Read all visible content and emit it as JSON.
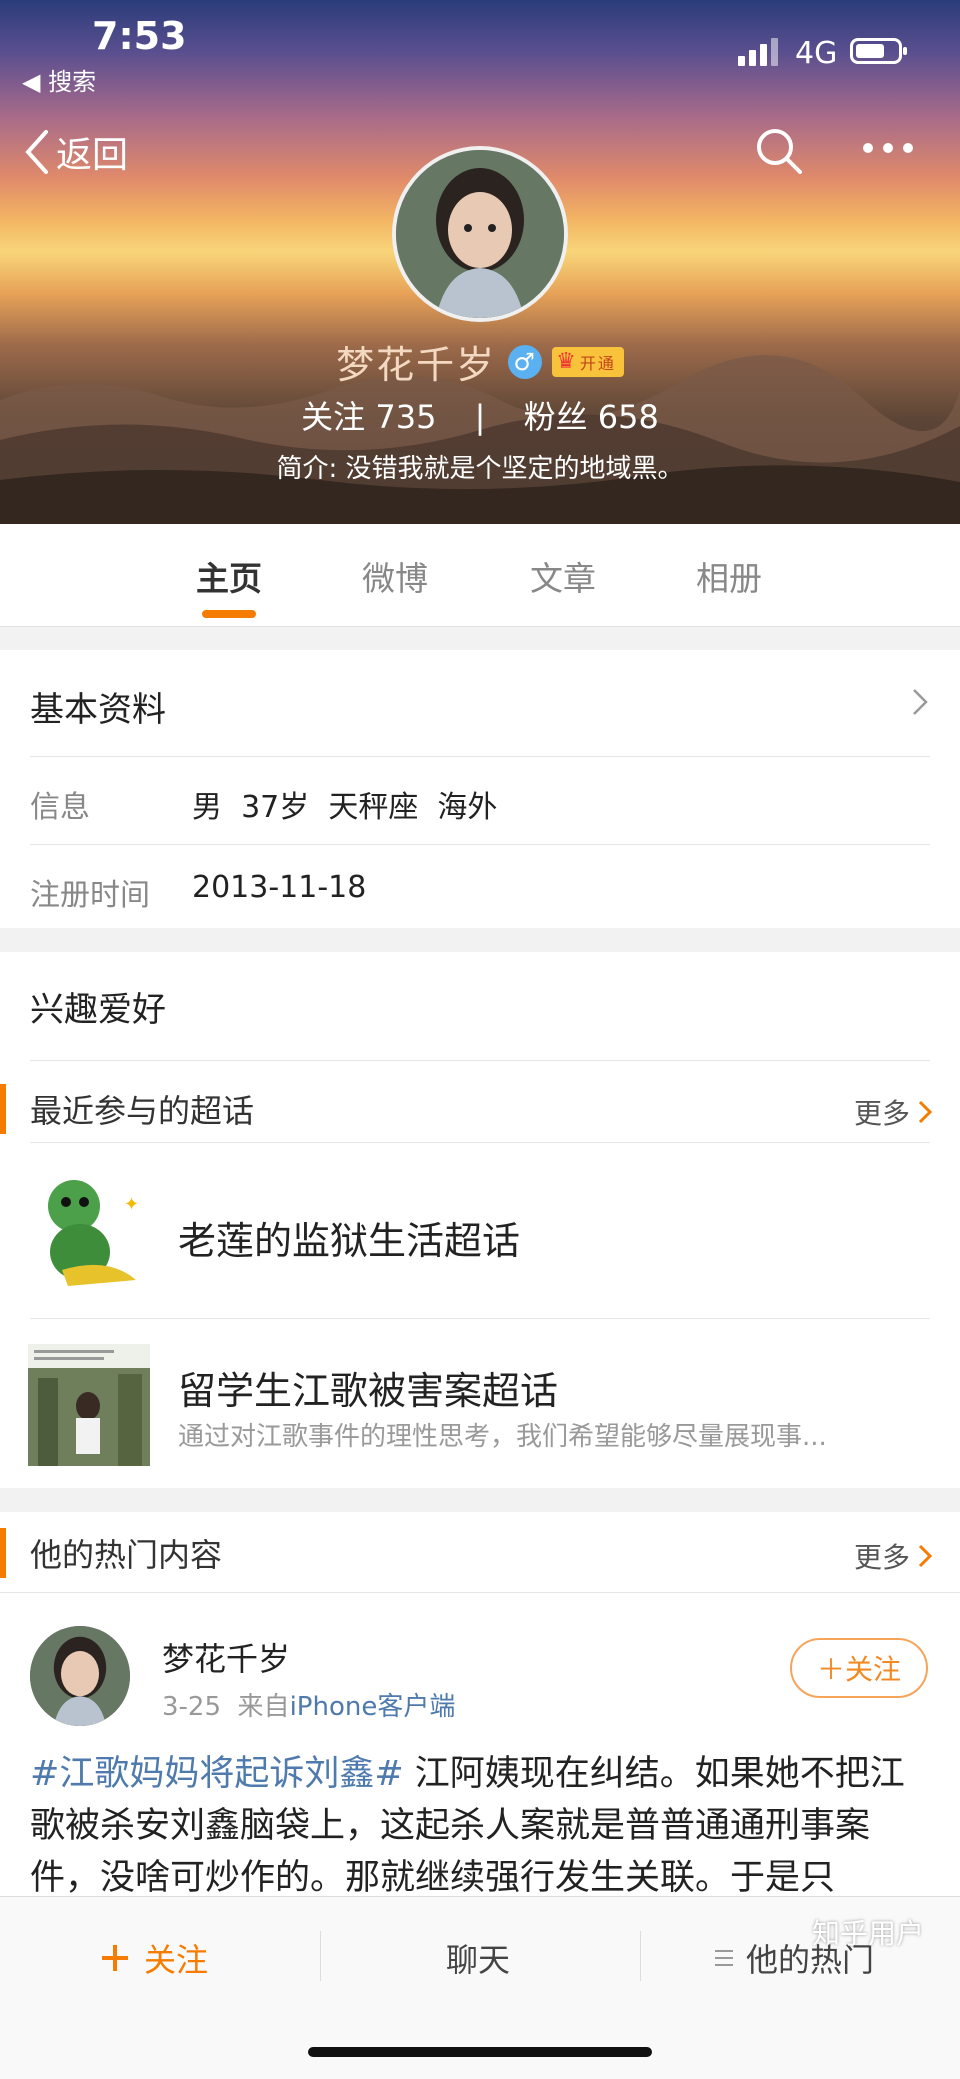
{
  "status_bar": {
    "time": "7:53",
    "back_app": "◀ 搜索",
    "network": "4G",
    "battery_level": 0.6
  },
  "nav": {
    "back_label": "返回",
    "icons": [
      "search-icon",
      "more-icon"
    ]
  },
  "profile": {
    "name": "梦花千岁",
    "gender_symbol": "♂",
    "vip_label": "开通",
    "following_label": "关注",
    "following_count": "735",
    "stats_separator": "|",
    "fans_label": "粉丝",
    "fans_count": "658",
    "bio": "简介: 没错我就是个坚定的地域黑。"
  },
  "tabs": [
    {
      "label": "主页",
      "active": true
    },
    {
      "label": "微博",
      "active": false
    },
    {
      "label": "文章",
      "active": false
    },
    {
      "label": "相册",
      "active": false
    }
  ],
  "basic_info": {
    "title": "基本资料",
    "info_label": "信息",
    "info_value": "男  37岁  天秤座  海外",
    "reg_label": "注册时间",
    "reg_value": "2013-11-18"
  },
  "interests": {
    "title": "兴趣爱好"
  },
  "super_topics": {
    "title": "最近参与的超话",
    "more_label": "更多",
    "items": [
      {
        "title": "老莲的监狱生活超话",
        "desc": ""
      },
      {
        "title": "留学生江歌被害案超话",
        "desc": "通过对江歌事件的理性思考，我们希望能够尽量展现事..."
      }
    ]
  },
  "hot_content": {
    "title": "他的热门内容",
    "more_label": "更多",
    "post": {
      "author": "梦花千岁",
      "date": "3-25",
      "from_label": "来自",
      "source": "iPhone客户端",
      "follow_label": "＋关注",
      "hashtag": "#江歌妈妈将起诉刘鑫#",
      "text": " 江阿姨现在纠结。如果她不把江歌被杀安刘鑫脑袋上，这起杀人案就是普普通通刑事案件，没啥可炒作的。那就继续强行发生关联。于是只"
    }
  },
  "bottom_bar": {
    "follow_label": "关注",
    "chat_label": "聊天",
    "hot_label": "他的热门"
  },
  "watermark": "知乎用户",
  "colors": {
    "accent": "#f57c00",
    "link": "#4e7aad"
  }
}
